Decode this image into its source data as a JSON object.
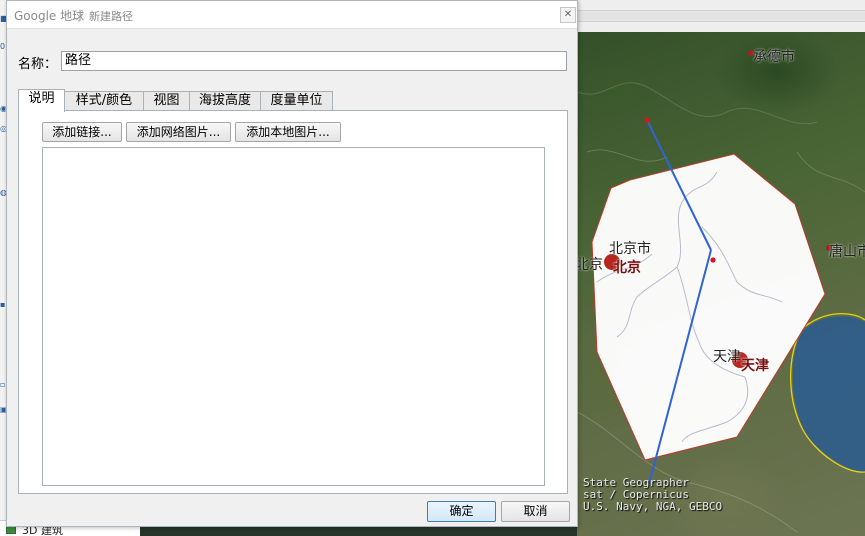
{
  "dialog": {
    "app_name": "Google 地球",
    "title": "新建路径",
    "name_label": "名称：",
    "name_value": "路径",
    "tabs": [
      {
        "label": "说明"
      },
      {
        "label": "样式/颜色"
      },
      {
        "label": "视图"
      },
      {
        "label": "海拔高度"
      },
      {
        "label": "度量单位"
      }
    ],
    "buttons": {
      "add_link": "添加链接...",
      "add_web_image": "添加网络图片...",
      "add_local_image": "添加本地图片..."
    },
    "description_value": "",
    "ok": "确定",
    "cancel": "取消",
    "close_glyph": "✕"
  },
  "map": {
    "labels": {
      "chengde": "承德市",
      "beijing_city": "北京市",
      "beijing": "北京",
      "beijing_left": "北京",
      "tianjin": "天津",
      "tianjin_prefix": "天津",
      "tangshan": "唐山市"
    },
    "attribution": [
      "State Geographer",
      "sat / Copernicus",
      "U.S. Navy, NGA, GEBCO"
    ]
  },
  "background_app": {
    "layer_label": "3D 建筑"
  },
  "colors": {
    "path_line": "#2f63d6",
    "polygon_fill": "#ffffff",
    "polygon_stroke": "#c0392b",
    "coast_line": "#e6d21a"
  }
}
